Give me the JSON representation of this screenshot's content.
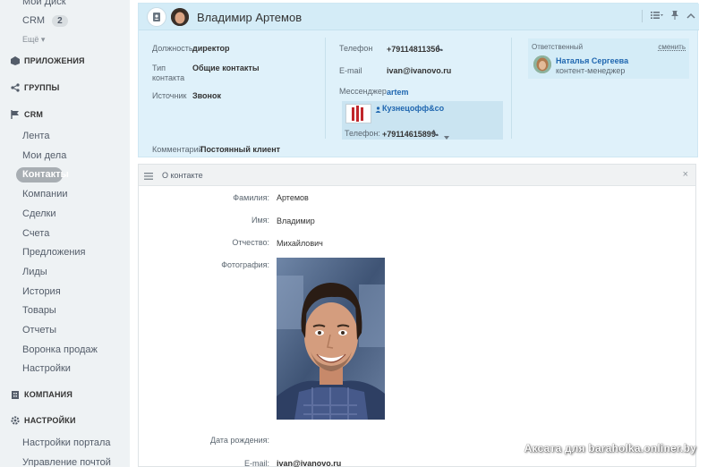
{
  "sidebar": {
    "top_items": [
      {
        "label": "Мой Диск"
      },
      {
        "label": "CRM",
        "badge": "2"
      }
    ],
    "more": "Ещё ▾",
    "sections": {
      "apps": "ПРИЛОЖЕНИЯ",
      "groups": "ГРУППЫ",
      "crm": "CRM",
      "company": "КОМПАНИЯ",
      "settings": "НАСТРОЙКИ"
    },
    "crm_items": [
      "Лента",
      "Мои дела",
      "Контакты",
      "Компании",
      "Сделки",
      "Счета",
      "Предложения",
      "Лиды",
      "История",
      "Товары",
      "Отчеты",
      "Воронка продаж",
      "Настройки"
    ],
    "settings_items": [
      "Настройки портала",
      "Управление почтой"
    ]
  },
  "contact": {
    "name": "Владимир Артемов",
    "fields": {
      "position": {
        "label": "Должность",
        "value": "директор"
      },
      "type": {
        "label": "Тип контакта",
        "value": "Общие контакты"
      },
      "source": {
        "label": "Источник",
        "value": "Звонок"
      },
      "comment": {
        "label": "Комментарий",
        "value": "Постоянный клиент"
      },
      "phone": {
        "label": "Телефон",
        "value": "+79114811356"
      },
      "email": {
        "label": "E-mail",
        "value": "ivan@ivanovo.ru"
      },
      "messenger": {
        "label": "Мессенджер",
        "value": "artem"
      }
    },
    "company": {
      "name": "Кузнецофф&co",
      "phone_label": "Телефон:",
      "phone": "+79114615899"
    },
    "responsible": {
      "label": "Ответственный",
      "change": "сменить",
      "name": "Наталья Сергеева",
      "role": "контент-менеджер"
    }
  },
  "about": {
    "title": "О контакте",
    "close": "×",
    "rows": {
      "lastname": {
        "label": "Фамилия:",
        "value": "Артемов"
      },
      "firstname": {
        "label": "Имя:",
        "value": "Владимир"
      },
      "patronymic": {
        "label": "Отчество:",
        "value": "Михайлович"
      },
      "photo": {
        "label": "Фотография:"
      },
      "birthday": {
        "label": "Дата рождения:",
        "value": ""
      },
      "email": {
        "label": "E-mail:",
        "value": "ivan@ivanovo.ru"
      }
    }
  },
  "watermark": "Аксата для baraholka.onliner.by",
  "colors": {
    "accent": "#2067b0",
    "card_bg": "#dff1fa",
    "sidebar_bg": "#eef2f4"
  }
}
